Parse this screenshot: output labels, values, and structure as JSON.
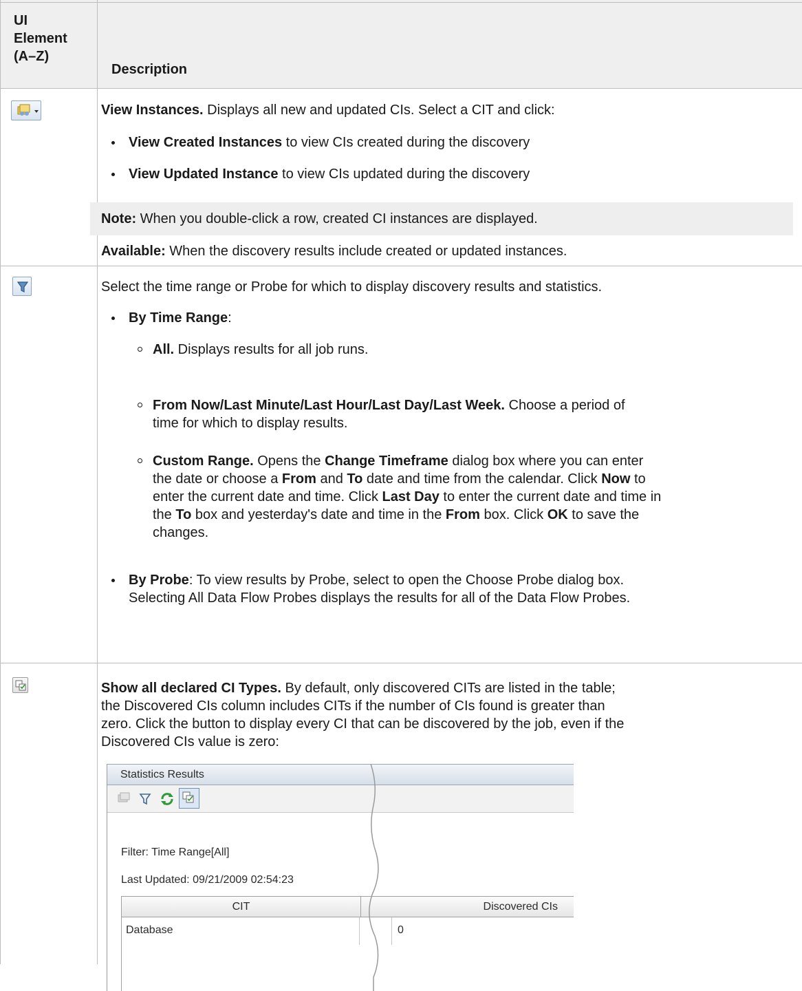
{
  "header": {
    "col1_lines": [
      "UI",
      "Element",
      "(A–Z)"
    ],
    "col2": "Description"
  },
  "row1": {
    "icon": "view-instances-icon",
    "title": "View Instances.",
    "intro": " Displays all new and updated CIs. Select a CIT and click:",
    "bullets": [
      {
        "bold": "View Created Instances",
        "text": " to view CIs created during the discovery"
      },
      {
        "bold": "View Updated Instance",
        "text": " to view CIs updated during the discovery"
      }
    ],
    "note_label": "Note:",
    "note_text": " When you double-click a row, created CI instances are displayed.",
    "available_label": "Available:",
    "available_text": " When the discovery results include created or updated instances."
  },
  "row2": {
    "icon": "filter-icon",
    "intro": "Select the time range or Probe for which to display discovery results and statistics.",
    "by_time_label": "By Time Range",
    "by_time_colon": ":",
    "all_label": "All.",
    "all_text": " Displays results for all job runs.",
    "from_label": "From Now/Last Minute/Last Hour/Last Day/Last Week.",
    "from_text": " Choose a period of",
    "from_text2": "time for which to display results.",
    "custom_label": "Custom Range.",
    "custom_t1": " Opens the ",
    "custom_b1": "Change Timeframe",
    "custom_t2": " dialog box where you can enter",
    "line2_t1": "the date or choose a ",
    "line2_b1": "From",
    "line2_t2": " and ",
    "line2_b2": "To",
    "line2_t3": " date and time from the calendar. Click ",
    "line2_b3": "Now",
    "line2_t4": " to",
    "line3_t1": "enter the current date and time. Click ",
    "line3_b1": "Last Day",
    "line3_t2": " to enter the current date and time in",
    "line4_t1": "the ",
    "line4_b1": "To",
    "line4_t2": " box and yesterday's date and time in the ",
    "line4_b2": "From",
    "line4_t3": " box. Click ",
    "line4_b3": "OK",
    "line4_t4": " to save the",
    "line5": "changes.",
    "by_probe_label": "By Probe",
    "by_probe_text": ": To view results by Probe, select to open the Choose Probe dialog box.",
    "by_probe_text2": "Selecting All Data Flow Probes displays the results for all of the Data Flow Probes."
  },
  "row3": {
    "icon": "show-all-cit-icon",
    "title": "Show all declared CI Types.",
    "t1": " By default, only discovered CITs are listed in the table;",
    "t2": "the Discovered CIs column includes CITs if the number of CIs found is greater than",
    "t3": "zero. Click the button to display every CI that can be discovered by the job, even if the",
    "t4": "Discovered CIs value is zero:"
  },
  "screenshot": {
    "title": "Statistics Results",
    "filter": "Filter: Time Range[All]",
    "updated": "Last Updated: 09/21/2009 02:54:23",
    "columns": [
      "CIT",
      "Discovered CIs"
    ],
    "rows": [
      {
        "cit": "Database",
        "count": "0"
      }
    ]
  }
}
